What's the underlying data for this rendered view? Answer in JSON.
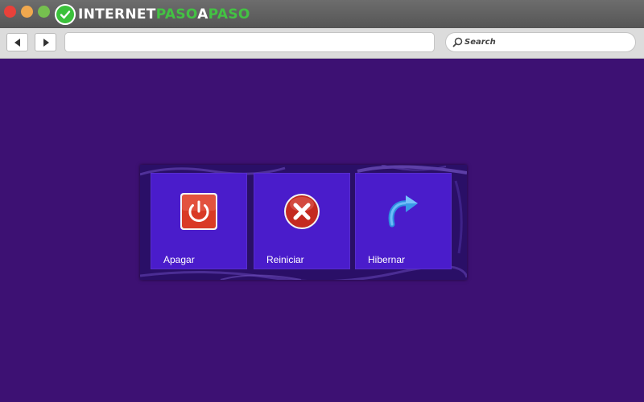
{
  "browser": {
    "logo": {
      "part_a": "INTERNET",
      "part_b": "PASO",
      "part_c": "A",
      "part_d": "PASO"
    },
    "address": {
      "value": ""
    },
    "search": {
      "placeholder": "Search"
    }
  },
  "dialog": {
    "options": [
      {
        "label": "Apagar",
        "icon": "power-icon"
      },
      {
        "label": "Reiniciar",
        "icon": "close-circle-icon"
      },
      {
        "label": "Hibernar",
        "icon": "redo-arrow-icon"
      }
    ]
  },
  "colors": {
    "desktop_bg": "#3d1173",
    "dialog_bg": "#2a0f67",
    "tile_bg": "#4a1ccb",
    "power_red": "#d93a26",
    "logo_green": "#43c243"
  }
}
